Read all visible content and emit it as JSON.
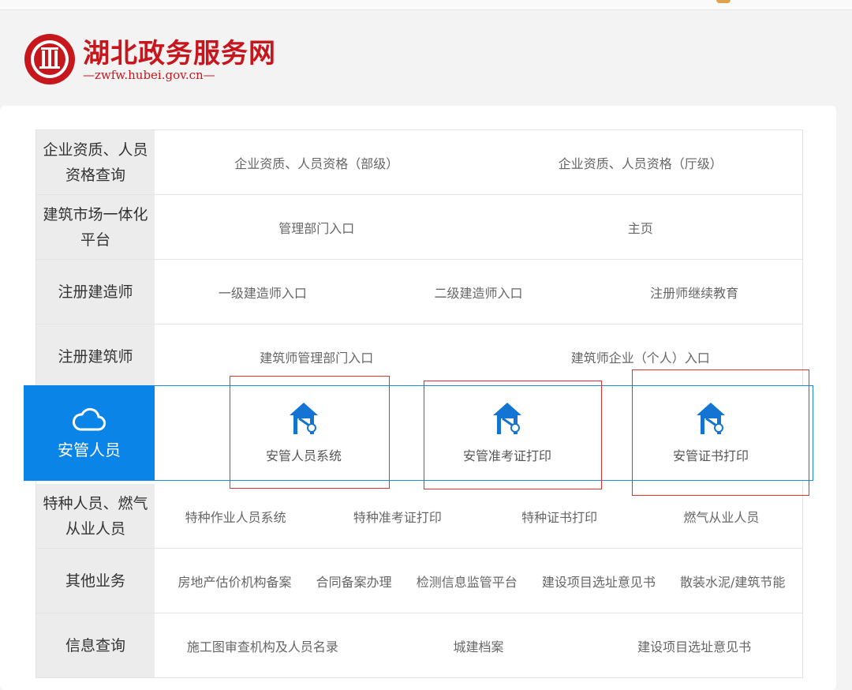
{
  "site": {
    "title": "湖北政务服务网",
    "url": "—zwfw.hubei.gov.cn—"
  },
  "categories": [
    {
      "title": "企业资质、人员资格查询",
      "links": [
        "企业资质、人员资格（部级）",
        "企业资质、人员资格（厅级）"
      ]
    },
    {
      "title": "建筑市场一体化平台",
      "links": [
        "管理部门入口",
        "主页"
      ]
    },
    {
      "title": "注册建造师",
      "links": [
        "一级建造师入口",
        "二级建造师入口",
        "注册师继续教育"
      ]
    },
    {
      "title": "注册建筑师",
      "links": [
        "建筑师管理部门入口",
        "建筑师企业（个人）入口"
      ]
    },
    {
      "title": "安管人员",
      "services": [
        "安管人员系统",
        "安管准考证打印",
        "安管证书打印"
      ],
      "icon": "cloud-icon",
      "service_icon": "house-key-icon",
      "accent": "#0b84e8"
    },
    {
      "title": "特种人员、燃气从业人员",
      "links": [
        "特种作业人员系统",
        "特种准考证打印",
        "特种证书打印",
        "燃气从业人员"
      ]
    },
    {
      "title": "其他业务",
      "links": [
        "房地产估价机构备案",
        "合同备案办理",
        "检测信息监管平台",
        "建设项目选址意见书",
        "散装水泥/建筑节能"
      ]
    },
    {
      "title": "信息查询",
      "links": [
        "施工图审查机构及人员名录",
        "城建档案",
        "建设项目选址意见书"
      ]
    }
  ],
  "colors": {
    "brand_red": "#c8161d",
    "highlight_blue": "#0b84e8",
    "annotation_red": "#e03030"
  }
}
